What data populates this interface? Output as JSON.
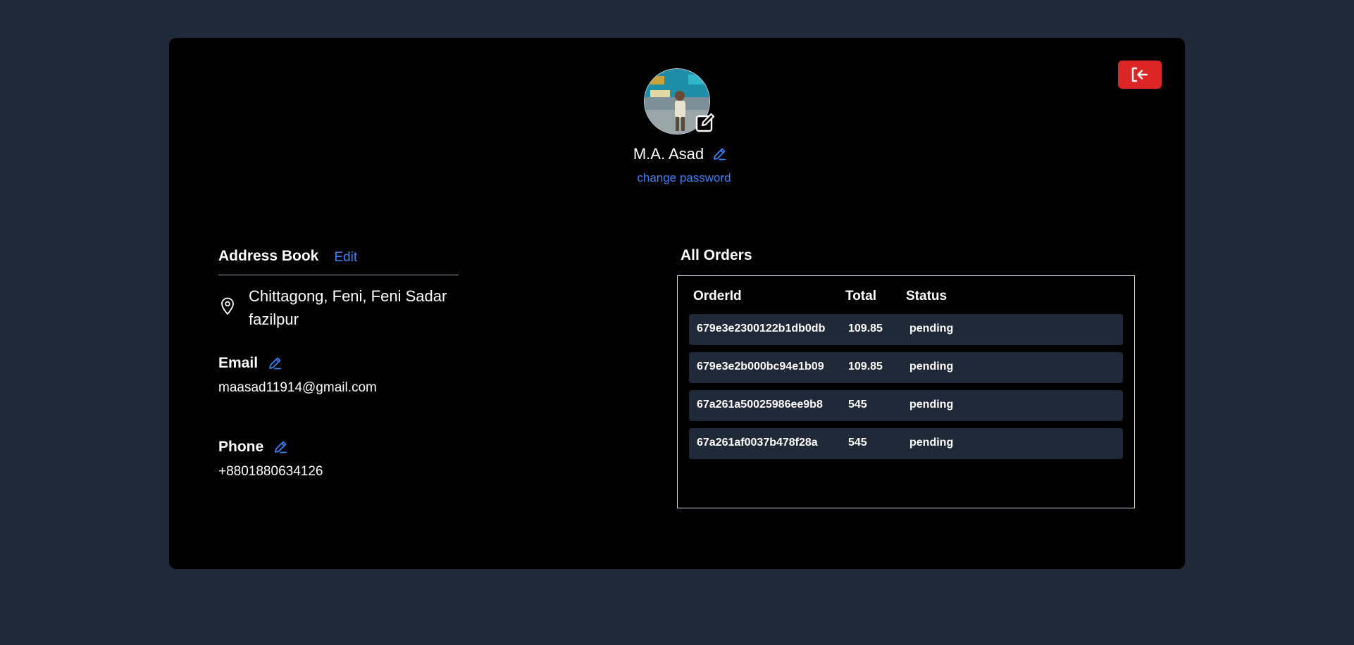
{
  "colors": {
    "page_bg": "#1f2937",
    "card_bg": "#000000",
    "accent": "#3b82f6",
    "danger": "#dc2626",
    "row_bg": "#1f2937"
  },
  "header": {
    "logout_icon": "logout-icon",
    "avatar_edit_icon": "edit-square-icon",
    "user_name": "M.A. Asad",
    "name_edit_icon": "pencil-icon",
    "change_password": "change password"
  },
  "address_book": {
    "title": "Address Book",
    "edit_label": "Edit",
    "icon": "map-pin-icon",
    "line1": "Chittagong, Feni, Feni Sadar",
    "line2": "fazilpur"
  },
  "email": {
    "label": "Email",
    "value": "maasad11914@gmail.com"
  },
  "phone": {
    "label": "Phone",
    "value": "+8801880634126"
  },
  "orders": {
    "title": "All Orders",
    "columns": [
      "OrderId",
      "Total",
      "Status"
    ],
    "rows": [
      {
        "id": "679e3e2300122b1db0db",
        "total": "109.85",
        "status": "pending"
      },
      {
        "id": "679e3e2b000bc94e1b09",
        "total": "109.85",
        "status": "pending"
      },
      {
        "id": "67a261a50025986ee9b8",
        "total": "545",
        "status": "pending"
      },
      {
        "id": "67a261af0037b478f28a",
        "total": "545",
        "status": "pending"
      }
    ]
  }
}
